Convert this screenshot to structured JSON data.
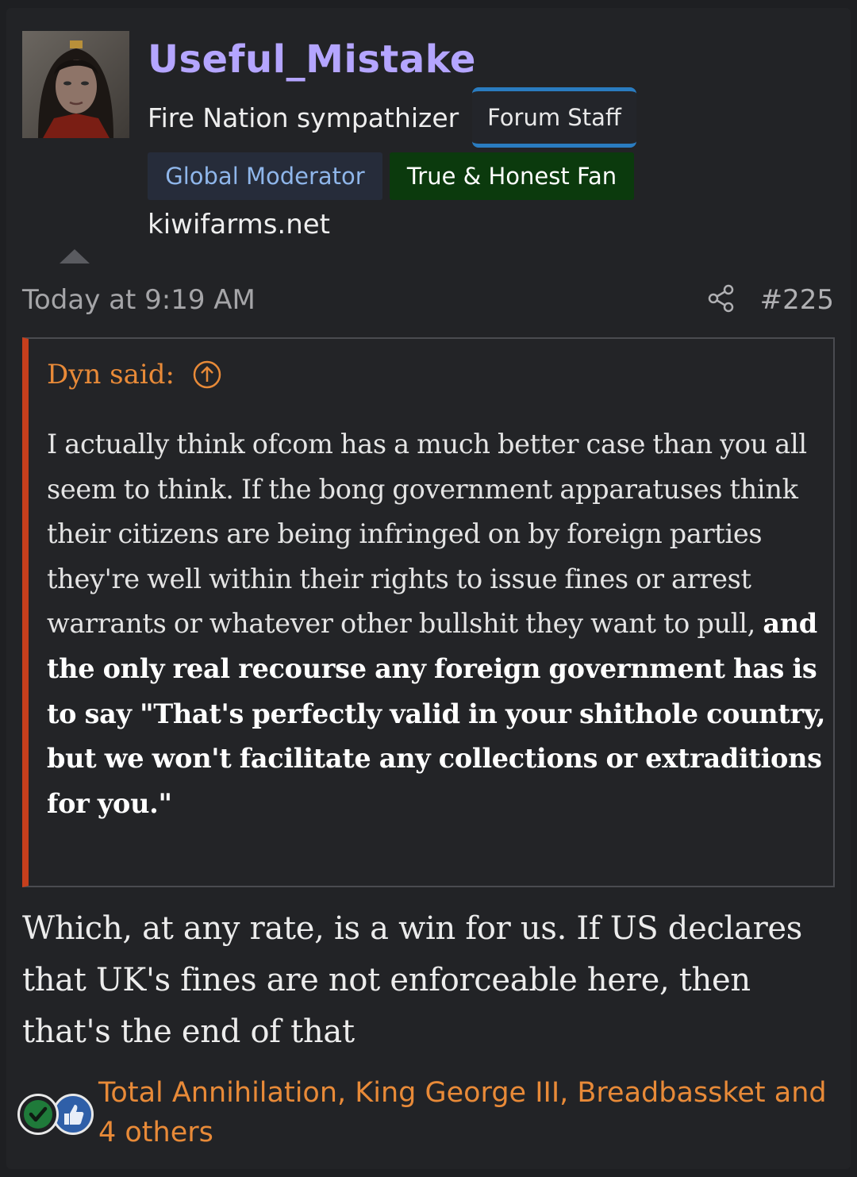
{
  "user": {
    "name": "Useful_Mistake",
    "title": "Fire Nation sympathizer",
    "banners": [
      "Forum Staff",
      "Global Moderator",
      "True & Honest Fan"
    ],
    "site": "kiwifarms.net",
    "avatar_icon": "avatar-portrait"
  },
  "post": {
    "timestamp": "Today at 9:19 AM",
    "number": "#225",
    "share_icon": "share-icon"
  },
  "quote": {
    "author": "Dyn said:",
    "text_plain": "I actually think ofcom has a much better case than you all seem to think. If the bong government apparatuses think their citizens are being infringed on by foreign parties they're well within their rights to issue fines or arrest warrants or whatever other bullshit they want to pull, ",
    "text_bold": "and the only real recourse any foreign government has is to say \"That's perfectly valid in your shithole country, but we won't facilitate any collections or extraditions for you.\""
  },
  "reply": "Which, at any rate, is a win for us. If US declares that UK's fines are not enforceable here, then that's the end of that",
  "reactions": {
    "text": "Total Annihilation, King George III, Breadbassket and 4 others",
    "icons": [
      "checkmark-reaction-icon",
      "thumbs-up-reaction-icon"
    ]
  },
  "colors": {
    "username": "#b4a5ff",
    "link_orange": "#e88a38",
    "quote_border": "#c63f1d",
    "staff_blue": "#2a7cc0",
    "fan_green": "#0b3a0d"
  }
}
